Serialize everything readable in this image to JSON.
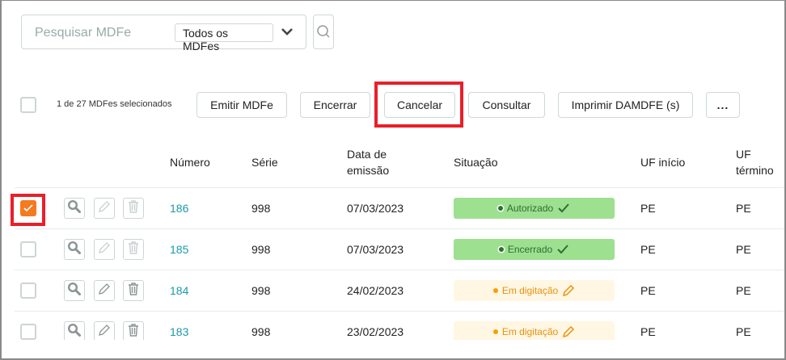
{
  "search": {
    "placeholder": "Pesquisar MDFe",
    "filter": "Todos os MDFes"
  },
  "selection": {
    "count_text": "1 de 27 MDFes selecionados"
  },
  "toolbar": {
    "emit": "Emitir MDFe",
    "close": "Encerrar",
    "cancel": "Cancelar",
    "query": "Consultar",
    "print": "Imprimir DAMDFE (s)",
    "more": "..."
  },
  "columns": {
    "numero": "Número",
    "serie": "Série",
    "data1": "Data de",
    "data2": "emissão",
    "situacao": "Situação",
    "uf_inicio": "UF início",
    "uf_termino1": "UF",
    "uf_termino2": "término"
  },
  "rows": [
    {
      "checked": true,
      "numero": "186",
      "serie": "998",
      "data": "07/03/2023",
      "situacao": "Autorizado",
      "status": "ok",
      "uf_inicio": "PE",
      "uf_termino": "PE",
      "editable": false
    },
    {
      "checked": false,
      "numero": "185",
      "serie": "998",
      "data": "07/03/2023",
      "situacao": "Encerrado",
      "status": "ok",
      "uf_inicio": "PE",
      "uf_termino": "PE",
      "editable": false
    },
    {
      "checked": false,
      "numero": "184",
      "serie": "998",
      "data": "24/02/2023",
      "situacao": "Em digitação",
      "status": "dig",
      "uf_inicio": "PE",
      "uf_termino": "PE",
      "editable": true
    },
    {
      "checked": false,
      "numero": "183",
      "serie": "998",
      "data": "23/02/2023",
      "situacao": "Em digitação",
      "status": "dig",
      "uf_inicio": "PE",
      "uf_termino": "PE",
      "editable": true
    }
  ],
  "colors": {
    "accent": "#f47b20",
    "link": "#1a9aa8",
    "highlight": "#e8202a",
    "ok_bg": "#9de08f",
    "dig_bg": "#fff7e3"
  }
}
